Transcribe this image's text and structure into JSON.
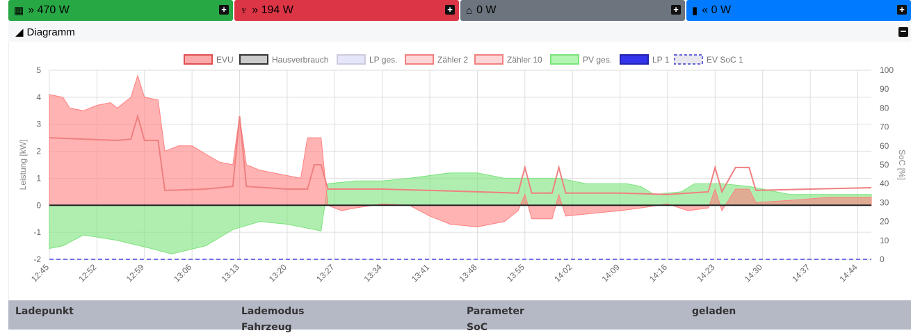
{
  "tiles": [
    {
      "icon": "solar-panel-icon",
      "glyph": "▦",
      "arrow": "»",
      "value": "470 W",
      "color": "#28a745"
    },
    {
      "icon": "power-tower-icon",
      "glyph": "⌂",
      "arrow": "»",
      "value": "194 W",
      "color": "#dc3545"
    },
    {
      "icon": "house-icon",
      "glyph": "⌂",
      "arrow": "",
      "value": "0 W",
      "color": "#6c757d"
    },
    {
      "icon": "battery-icon",
      "glyph": "▮",
      "arrow": "«",
      "value": "0 W",
      "color": "#007bff"
    }
  ],
  "section": {
    "title": "Diagramm"
  },
  "chart_data": {
    "type": "area",
    "legend": [
      "EVU",
      "Hausverbrauch",
      "LP ges.",
      "Zähler 2",
      "Zähler 10",
      "PV ges.",
      "LP 1",
      "EV SoC 1"
    ],
    "ylabel": "Leistung [kW]",
    "y2label": "SoC [%]",
    "ylim": [
      -2,
      5
    ],
    "y2lim": [
      0,
      100
    ],
    "yticks": [
      "5",
      "4",
      "3",
      "2",
      "1",
      "0",
      "-1",
      "-2"
    ],
    "y2ticks": [
      "100",
      "90",
      "80",
      "70",
      "60",
      "50",
      "40",
      "30",
      "20",
      "10",
      "0"
    ],
    "xticks": [
      "12:45",
      "12:52",
      "12:59",
      "13:06",
      "13:13",
      "13:20",
      "13:27",
      "13:34",
      "13:41",
      "13:48",
      "13:55",
      "14:02",
      "14:09",
      "14:16",
      "14:23",
      "14:30",
      "14:37",
      "14:44"
    ],
    "xrange": [
      "12:45",
      "14:46"
    ],
    "series": [
      {
        "name": "PV ges.",
        "color": "#7be37b",
        "points": [
          [
            "12:45",
            -1.6
          ],
          [
            "12:47",
            -1.5
          ],
          [
            "12:50",
            -1.1
          ],
          [
            "12:55",
            -1.3
          ],
          [
            "13:00",
            -1.6
          ],
          [
            "13:03",
            -1.8
          ],
          [
            "13:08",
            -1.5
          ],
          [
            "13:12",
            -0.9
          ],
          [
            "13:16",
            -0.6
          ],
          [
            "13:20",
            -0.7
          ],
          [
            "13:25",
            -0.95
          ],
          [
            "13:26",
            0.8
          ],
          [
            "13:30",
            0.9
          ],
          [
            "13:34",
            0.9
          ],
          [
            "13:38",
            1.0
          ],
          [
            "13:44",
            1.2
          ],
          [
            "13:48",
            1.2
          ],
          [
            "13:52",
            1.0
          ],
          [
            "13:56",
            1.0
          ],
          [
            "14:00",
            1.0
          ],
          [
            "14:04",
            0.8
          ],
          [
            "14:10",
            0.8
          ],
          [
            "14:12",
            0.7
          ],
          [
            "14:14",
            0.4
          ],
          [
            "14:18",
            0.5
          ],
          [
            "14:20",
            0.8
          ],
          [
            "14:24",
            0.8
          ],
          [
            "14:28",
            0.7
          ],
          [
            "14:34",
            0.4
          ],
          [
            "14:40",
            0.4
          ],
          [
            "14:46",
            0.4
          ]
        ]
      },
      {
        "name": "EVU",
        "color": "#ff8080",
        "points": [
          [
            "12:45",
            4.1
          ],
          [
            "12:47",
            4.0
          ],
          [
            "12:48",
            3.6
          ],
          [
            "12:50",
            3.5
          ],
          [
            "12:52",
            3.7
          ],
          [
            "12:54",
            3.8
          ],
          [
            "12:55",
            3.6
          ],
          [
            "12:57",
            4.0
          ],
          [
            "12:58",
            4.8
          ],
          [
            "12:59",
            4.0
          ],
          [
            "13:01",
            3.9
          ],
          [
            "13:02",
            2.0
          ],
          [
            "13:04",
            2.2
          ],
          [
            "13:06",
            2.2
          ],
          [
            "13:08",
            1.9
          ],
          [
            "13:10",
            1.6
          ],
          [
            "13:12",
            1.5
          ],
          [
            "13:13",
            3.3
          ],
          [
            "13:14",
            1.5
          ],
          [
            "13:16",
            1.3
          ],
          [
            "13:18",
            1.2
          ],
          [
            "13:20",
            1.1
          ],
          [
            "13:22",
            1.0
          ],
          [
            "13:23",
            2.5
          ],
          [
            "13:25",
            2.5
          ],
          [
            "13:26",
            0
          ],
          [
            "13:28",
            -0.2
          ],
          [
            "13:30",
            -0.1
          ],
          [
            "13:34",
            0.05
          ],
          [
            "13:38",
            0.0
          ],
          [
            "13:41",
            -0.4
          ],
          [
            "13:44",
            -0.7
          ],
          [
            "13:48",
            -0.8
          ],
          [
            "13:52",
            -0.6
          ],
          [
            "13:54",
            -0.2
          ],
          [
            "13:55",
            0.4
          ],
          [
            "13:56",
            -0.5
          ],
          [
            "13:59",
            -0.5
          ],
          [
            "14:00",
            0.4
          ],
          [
            "14:01",
            -0.4
          ],
          [
            "14:05",
            -0.3
          ],
          [
            "14:09",
            -0.2
          ],
          [
            "14:12",
            -0.1
          ],
          [
            "14:16",
            0.05
          ],
          [
            "14:19",
            -0.2
          ],
          [
            "14:22",
            -0.1
          ],
          [
            "14:23",
            0.6
          ],
          [
            "14:24",
            -0.2
          ],
          [
            "14:26",
            0.6
          ],
          [
            "14:28",
            0.6
          ],
          [
            "14:29",
            0.1
          ],
          [
            "14:35",
            0.2
          ],
          [
            "14:40",
            0.3
          ],
          [
            "14:46",
            0.3
          ]
        ]
      },
      {
        "name": "Zähler 2",
        "color": "#f08080",
        "points": [
          [
            "12:45",
            2.5
          ],
          [
            "12:50",
            2.45
          ],
          [
            "12:55",
            2.4
          ],
          [
            "12:57",
            2.45
          ],
          [
            "12:58",
            3.3
          ],
          [
            "12:59",
            2.4
          ],
          [
            "13:01",
            2.4
          ],
          [
            "13:02",
            0.55
          ],
          [
            "13:08",
            0.6
          ],
          [
            "13:12",
            0.7
          ],
          [
            "13:13",
            3.3
          ],
          [
            "13:14",
            0.7
          ],
          [
            "13:20",
            0.6
          ],
          [
            "13:23",
            0.6
          ],
          [
            "13:24",
            1.5
          ],
          [
            "13:25",
            1.5
          ],
          [
            "13:26",
            0.6
          ],
          [
            "13:34",
            0.6
          ],
          [
            "13:41",
            0.55
          ],
          [
            "13:48",
            0.5
          ],
          [
            "13:54",
            0.45
          ],
          [
            "13:55",
            1.4
          ],
          [
            "13:56",
            0.45
          ],
          [
            "13:59",
            0.45
          ],
          [
            "14:00",
            1.4
          ],
          [
            "14:01",
            0.45
          ],
          [
            "14:09",
            0.45
          ],
          [
            "14:16",
            0.4
          ],
          [
            "14:22",
            0.5
          ],
          [
            "14:23",
            1.4
          ],
          [
            "14:24",
            0.5
          ],
          [
            "14:26",
            1.4
          ],
          [
            "14:28",
            1.4
          ],
          [
            "14:29",
            0.55
          ],
          [
            "14:37",
            0.6
          ],
          [
            "14:46",
            0.65
          ]
        ]
      }
    ],
    "soc": {
      "name": "EV SoC 1",
      "value": 0
    }
  },
  "table": {
    "headers": [
      "Ladepunkt",
      "Lademodus",
      "Parameter",
      "geladen"
    ],
    "sub": [
      "Fahrzeug",
      "SoC"
    ]
  }
}
